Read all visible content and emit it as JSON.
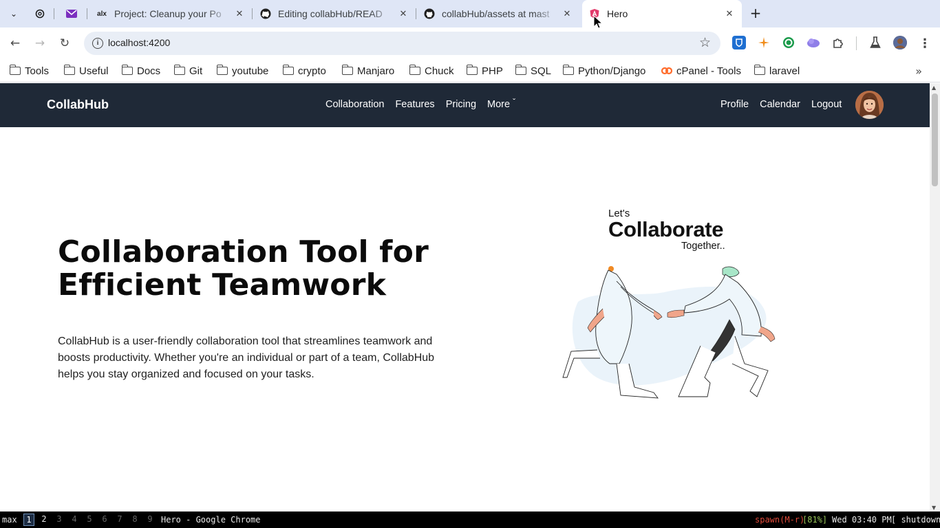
{
  "browser": {
    "tabs": [
      {
        "title": "",
        "icon": "openai-icon",
        "active": false
      },
      {
        "title": "",
        "icon": "mail-icon",
        "active": false
      },
      {
        "title": "Project: Cleanup your Po",
        "icon": "alx-icon",
        "icon_text": "alx",
        "active": false
      },
      {
        "title": "Editing collabHub/READ",
        "icon": "github-icon",
        "active": false
      },
      {
        "title": "collabHub/assets at mast",
        "icon": "github-icon",
        "active": false
      },
      {
        "title": "Hero",
        "icon": "angular-icon",
        "active": true
      }
    ],
    "url": "localhost:4200",
    "bookmarks": [
      "Tools",
      "Useful",
      "Docs",
      "Git",
      "youtube",
      "crypto",
      "Manjaro",
      "Chuck",
      "PHP",
      "SQL",
      "Python/Django",
      "cPanel - Tools",
      "laravel"
    ]
  },
  "site": {
    "brand": "CollabHub",
    "menu": [
      "Collaboration",
      "Features",
      "Pricing",
      "More"
    ],
    "more_caret": "ˇ",
    "menu_right": [
      "Profile",
      "Calendar",
      "Logout"
    ],
    "hero": {
      "title": "Collaboration Tool for Efficient Teamwork",
      "text": "CollabHub is a user-friendly collaboration tool that streamlines teamwork and boosts productivity. Whether you're an individual or part of a team, CollabHub helps you stay organized and focused on your tasks.",
      "illustration": {
        "lets": "Let's",
        "collaborate": "Collaborate",
        "together": "Together.."
      }
    }
  },
  "osbar": {
    "layout": "max",
    "workspaces": [
      "1",
      "2",
      "3",
      "4",
      "5",
      "6",
      "7",
      "8",
      "9"
    ],
    "active_workspace": "1",
    "window_title": "Hero - Google Chrome",
    "spawn": "spawn(M-r)",
    "battery": "[81%]",
    "datetime": "Wed 03:40 PM",
    "shutdown": "[ shutdown ]"
  },
  "colors": {
    "navbar": "#1f2937",
    "tabstrip": "#dfe6f6",
    "omnibox": "#e9eef6",
    "spawn": "#e04a3a",
    "battery": "#9ac85a"
  }
}
